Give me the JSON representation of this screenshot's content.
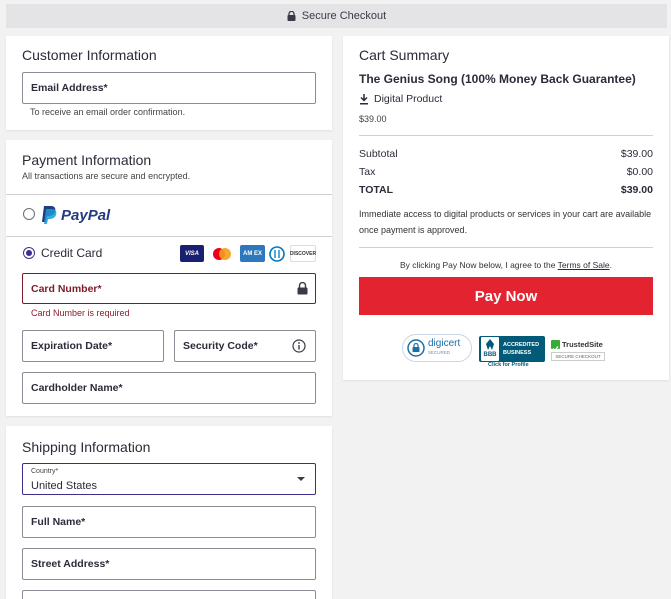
{
  "header": {
    "title": "Secure Checkout"
  },
  "customer": {
    "title": "Customer Information",
    "email_label": "Email Address*",
    "email_hint": "To receive an email order confirmation."
  },
  "payment": {
    "title": "Payment Information",
    "subtitle": "All transactions are secure and encrypted.",
    "paypal_label": "PayPal",
    "credit_card_label": "Credit Card",
    "card_number_label": "Card Number*",
    "card_number_error": "Card Number is required",
    "expiration_label": "Expiration Date*",
    "security_code_label": "Security Code*",
    "cardholder_label": "Cardholder Name*",
    "card_brands": {
      "visa": "VISA",
      "amex": "AM EX",
      "discover": "DISCOVER"
    }
  },
  "shipping": {
    "title": "Shipping Information",
    "country_label": "Country*",
    "country_value": "United States",
    "full_name_label": "Full Name*",
    "street_label": "Street Address*"
  },
  "cart": {
    "title": "Cart Summary",
    "product_name": "The Genius Song (100% Money Back Guarantee)",
    "product_type": "Digital Product",
    "product_price": "$39.00",
    "subtotal_label": "Subtotal",
    "subtotal_value": "$39.00",
    "tax_label": "Tax",
    "tax_value": "$0.00",
    "total_label": "TOTAL",
    "total_value": "$39.00",
    "access_note": "Immediate access to digital products or services in your cart are available once payment is approved.",
    "terms_prefix": "By clicking Pay Now below, I agree to the ",
    "terms_link": "Terms of Sale",
    "terms_suffix": ".",
    "pay_button": "Pay Now"
  },
  "badges": {
    "digicert": "digicert",
    "digicert_sub": "SECURED",
    "bbb_line1": "ACCREDITED",
    "bbb_line2": "BUSINESS",
    "bbb_abbr": "BBB",
    "bbb_link": "Click for Profile",
    "trustedsite": "TrustedSite",
    "trustedsite_sub": "SECURE CHECKOUT"
  },
  "colors": {
    "accent": "#3a2f8c",
    "pay": "#e42330",
    "error": "#7d1c28"
  }
}
